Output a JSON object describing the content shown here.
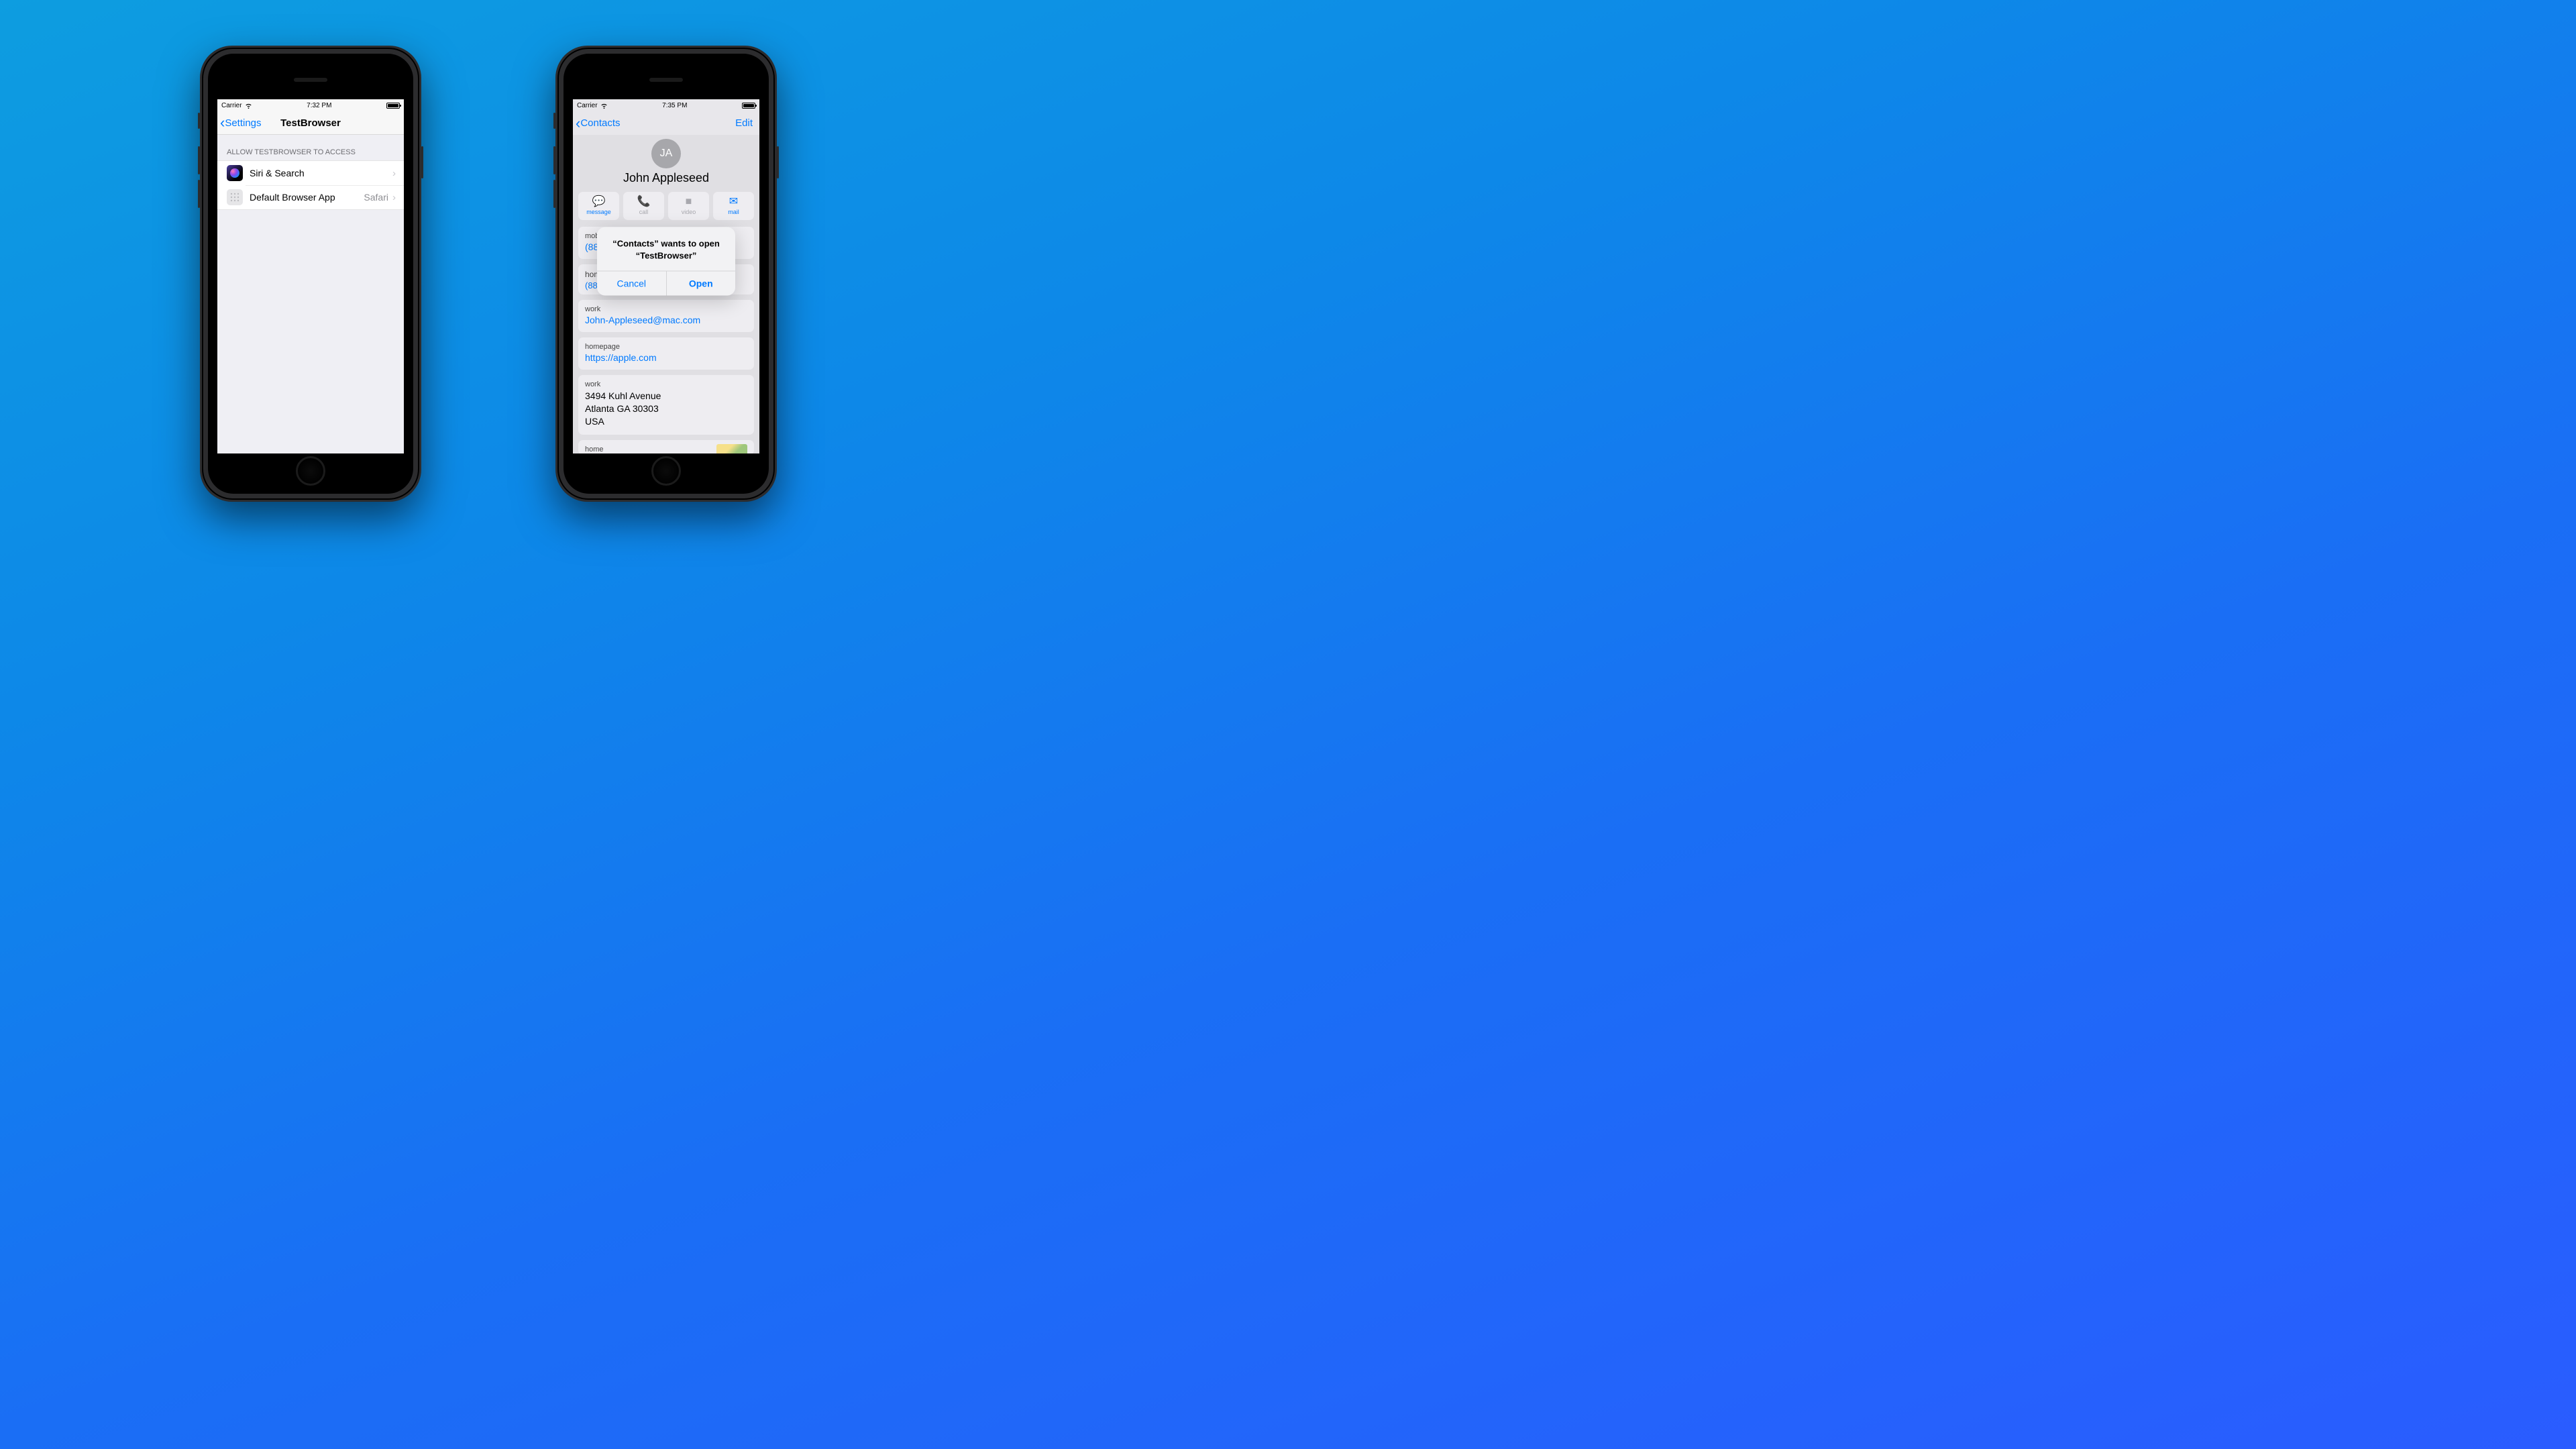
{
  "leftPhone": {
    "status": {
      "carrier": "Carrier",
      "time": "7:32 PM"
    },
    "nav": {
      "back": "Settings",
      "title": "TestBrowser"
    },
    "sectionHeader": "ALLOW TESTBROWSER TO ACCESS",
    "rows": {
      "siri": {
        "label": "Siri & Search"
      },
      "defaultBrowser": {
        "label": "Default Browser App",
        "value": "Safari"
      }
    }
  },
  "rightPhone": {
    "status": {
      "carrier": "Carrier",
      "time": "7:35 PM"
    },
    "nav": {
      "back": "Contacts",
      "editLabel": "Edit"
    },
    "contact": {
      "initials": "JA",
      "name": "John Appleseed",
      "actions": {
        "message": "message",
        "call": "call",
        "video": "video",
        "mail": "mail"
      },
      "cards": [
        {
          "label": "mobile",
          "value": "(888) 555-5512",
          "blue": true
        },
        {
          "label": "hom",
          "valuePartial": "(88"
        },
        {
          "label": "work",
          "value": "John-Appleseed@mac.com",
          "blue": true
        },
        {
          "label": "homepage",
          "value": "https://apple.com",
          "blue": true
        },
        {
          "label": "work",
          "value": "3494 Kuhl Avenue\nAtlanta GA 30303\nUSA",
          "blue": false
        },
        {
          "label": "home"
        }
      ]
    },
    "alert": {
      "message": "“Contacts” wants to open “TestBrowser”",
      "cancel": "Cancel",
      "open": "Open"
    }
  }
}
